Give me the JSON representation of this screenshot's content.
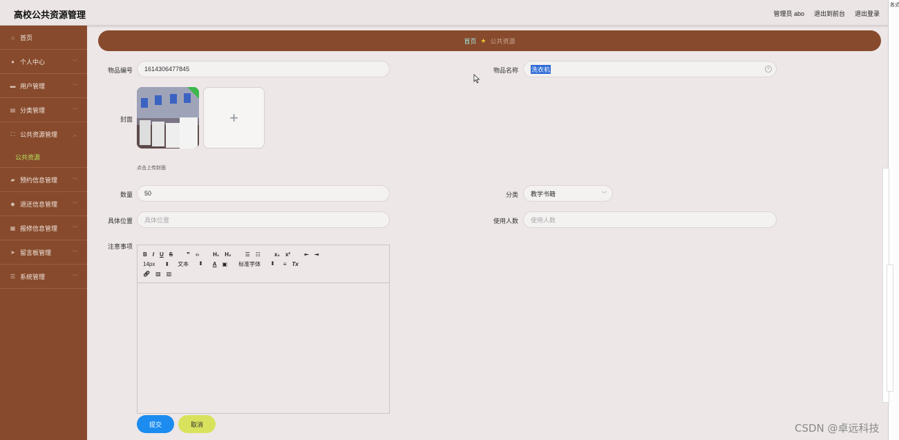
{
  "app": {
    "title": "高校公共资源管理",
    "user_label": "管理员 abo",
    "front_link": "退出到前台",
    "logout_link": "退出登录"
  },
  "sidebar": {
    "items": [
      {
        "label": "首页",
        "icon": "home-icon"
      },
      {
        "label": "个人中心",
        "icon": "user-icon"
      },
      {
        "label": "用户管理",
        "icon": "users-icon"
      },
      {
        "label": "分类管理",
        "icon": "category-icon"
      },
      {
        "label": "公共资源管理",
        "icon": "resource-icon"
      },
      {
        "label": "预约信息管理",
        "icon": "calendar-icon"
      },
      {
        "label": "退还信息管理",
        "icon": "return-icon"
      },
      {
        "label": "报修信息管理",
        "icon": "repair-icon"
      },
      {
        "label": "留言板管理",
        "icon": "message-icon"
      },
      {
        "label": "系统管理",
        "icon": "settings-icon"
      }
    ],
    "active_sub": "公共资源"
  },
  "breadcrumb": {
    "home": "首页",
    "current": "公共资源"
  },
  "form": {
    "item_no_label": "物品编号",
    "item_no_value": "1614306477845",
    "item_name_label": "物品名称",
    "item_name_value": "洗衣机",
    "cover_label": "封面",
    "cover_tip": "点击上传封面",
    "qty_label": "数量",
    "qty_value": "50",
    "category_label": "分类",
    "category_value": "教学书籍",
    "location_label": "具体位置",
    "location_placeholder": "具体位置",
    "users_label": "使用人数",
    "users_placeholder": "使用人数",
    "notes_label": "注意事项"
  },
  "editor": {
    "font_size": "14px",
    "text_type": "文本",
    "font_family": "标准字体"
  },
  "buttons": {
    "submit": "提交",
    "cancel": "取消"
  },
  "right_strip_text": "各式R",
  "watermark": "CSDN @卓远科技"
}
